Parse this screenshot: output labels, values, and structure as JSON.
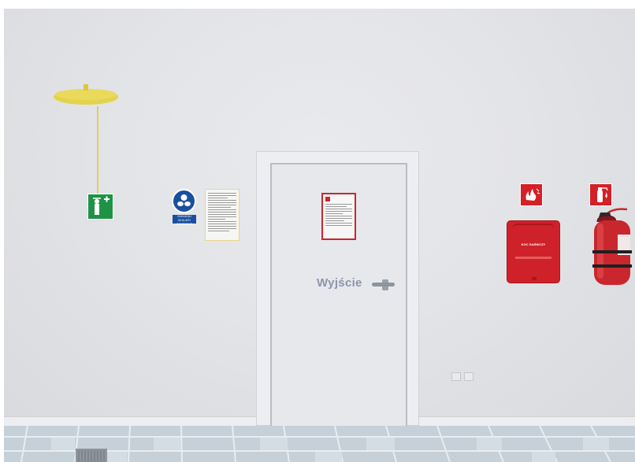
{
  "scene": {
    "door_label": "Wyjście",
    "mandatory_sign_caption": "ZAKŁADAJ OKULARY OCHRONNE",
    "fire_blanket_label": "KOC GAŚNICZY"
  },
  "colors": {
    "wall": "#e3e4e7",
    "door": "#e6e8ec",
    "shower_yellow": "#e3d34a",
    "safety_green": "#1e9346",
    "mandatory_blue": "#1a4f9e",
    "fire_red": "#d42027",
    "floor_tile": "#c9d3dc"
  },
  "icons": {
    "eyewash": "eye-shower-icon",
    "goggles": "safety-goggles-icon",
    "fire_alarm": "fire-alarm-icon",
    "extinguisher_sign": "extinguisher-sign-icon"
  }
}
